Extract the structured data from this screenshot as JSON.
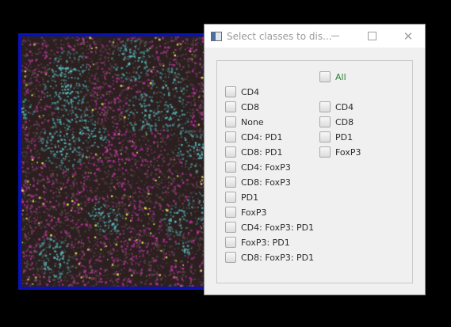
{
  "dialog": {
    "title": "Select classes to dis...",
    "icons": {
      "app": "app-window-icon",
      "minimize": "minimize-icon",
      "maximize": "maximize-icon",
      "close": "close-icon"
    },
    "all_label": "All",
    "left_items": [
      "CD4",
      "CD8",
      "None",
      "CD4: PD1",
      "CD8: PD1",
      "CD4: FoxP3",
      "CD8: FoxP3",
      "PD1",
      "FoxP3",
      "CD4: FoxP3: PD1",
      "FoxP3: PD1",
      "CD8: FoxP3: PD1"
    ],
    "right_items": [
      "CD4",
      "CD8",
      "PD1",
      "FoxP3"
    ]
  },
  "colors": {
    "viewer_border": "#0b12b3",
    "all_label": "#2e7d32"
  }
}
